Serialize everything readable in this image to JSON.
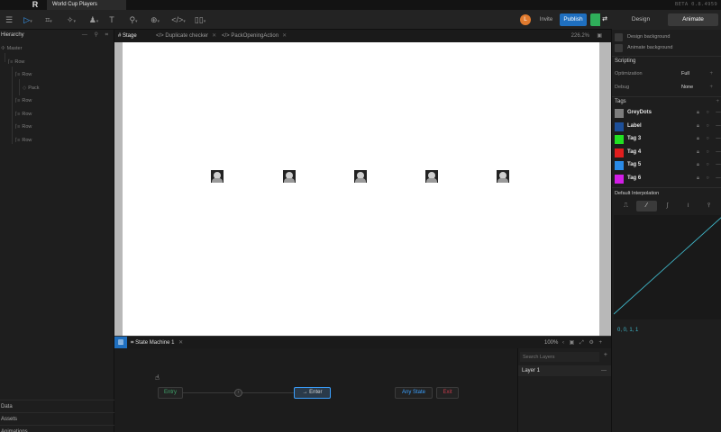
{
  "titlebar": {
    "logo": "R",
    "file_tab": "World Cup Players",
    "beta": "BETA 0.8.4959"
  },
  "toolbar": {
    "avatar_initial": "L",
    "invite": "Invite",
    "publish": "Publish",
    "share_glyph": "⇄",
    "modes": [
      "Design",
      "Animate"
    ],
    "active_mode": "Animate"
  },
  "hierarchy": {
    "title": "Hierarchy",
    "items": [
      {
        "label": "Master",
        "glyph": "✣"
      },
      {
        "label": "Row",
        "glyph": "⌈≡"
      },
      {
        "label": "Row",
        "glyph": "⌈≡"
      },
      {
        "label": "Pack",
        "glyph": "◇"
      },
      {
        "label": "Row",
        "glyph": "⌈≡"
      },
      {
        "label": "Row",
        "glyph": "⌈≡"
      },
      {
        "label": "Row",
        "glyph": "⌈≡"
      },
      {
        "label": "Row",
        "glyph": "⌈≡"
      }
    ],
    "bottom_tabs": [
      "Data",
      "Assets",
      "Animations"
    ]
  },
  "doc_tabs": [
    {
      "label": "Stage",
      "icon": "#"
    },
    {
      "label": "Duplicate checker",
      "icon": "</>"
    },
    {
      "label": "PackOpeningAction",
      "icon": "</>"
    }
  ],
  "stage": {
    "zoom": "226.2%",
    "card_count": 5
  },
  "state_machine": {
    "tab": "State Machine 1",
    "zoom": "100%",
    "states": {
      "entry": "Entry",
      "enter": "Enter",
      "enter_glyph": "→",
      "any": "Any State",
      "exit": "Exit"
    }
  },
  "layers": {
    "search_placeholder": "Search Layers",
    "items": [
      "Layer 1"
    ]
  },
  "inspector": {
    "checkboxes": [
      "Design background",
      "Animate background"
    ],
    "scripting_title": "Scripting",
    "optimization_label": "Optimization",
    "optimization_value": "Full",
    "debug_label": "Debug",
    "debug_value": "None",
    "tags_title": "Tags",
    "tags": [
      {
        "name": "GreyDots",
        "color": "#7d7d7d"
      },
      {
        "name": "Label",
        "color": "#1d4f99"
      },
      {
        "name": "Tag 3",
        "color": "#22e022"
      },
      {
        "name": "Tag 4",
        "color": "#e01e1e"
      },
      {
        "name": "Tag 5",
        "color": "#2a8ae6"
      },
      {
        "name": "Tag 6",
        "color": "#d21ee6"
      }
    ],
    "interpolation_title": "Default Interpolation",
    "curve_values": "0, 0, 1, 1"
  },
  "colors": {
    "accent": "#1f6fbf",
    "curve": "#3fb6c8",
    "entry": "#3fa36a",
    "exit": "#c53b4a"
  }
}
